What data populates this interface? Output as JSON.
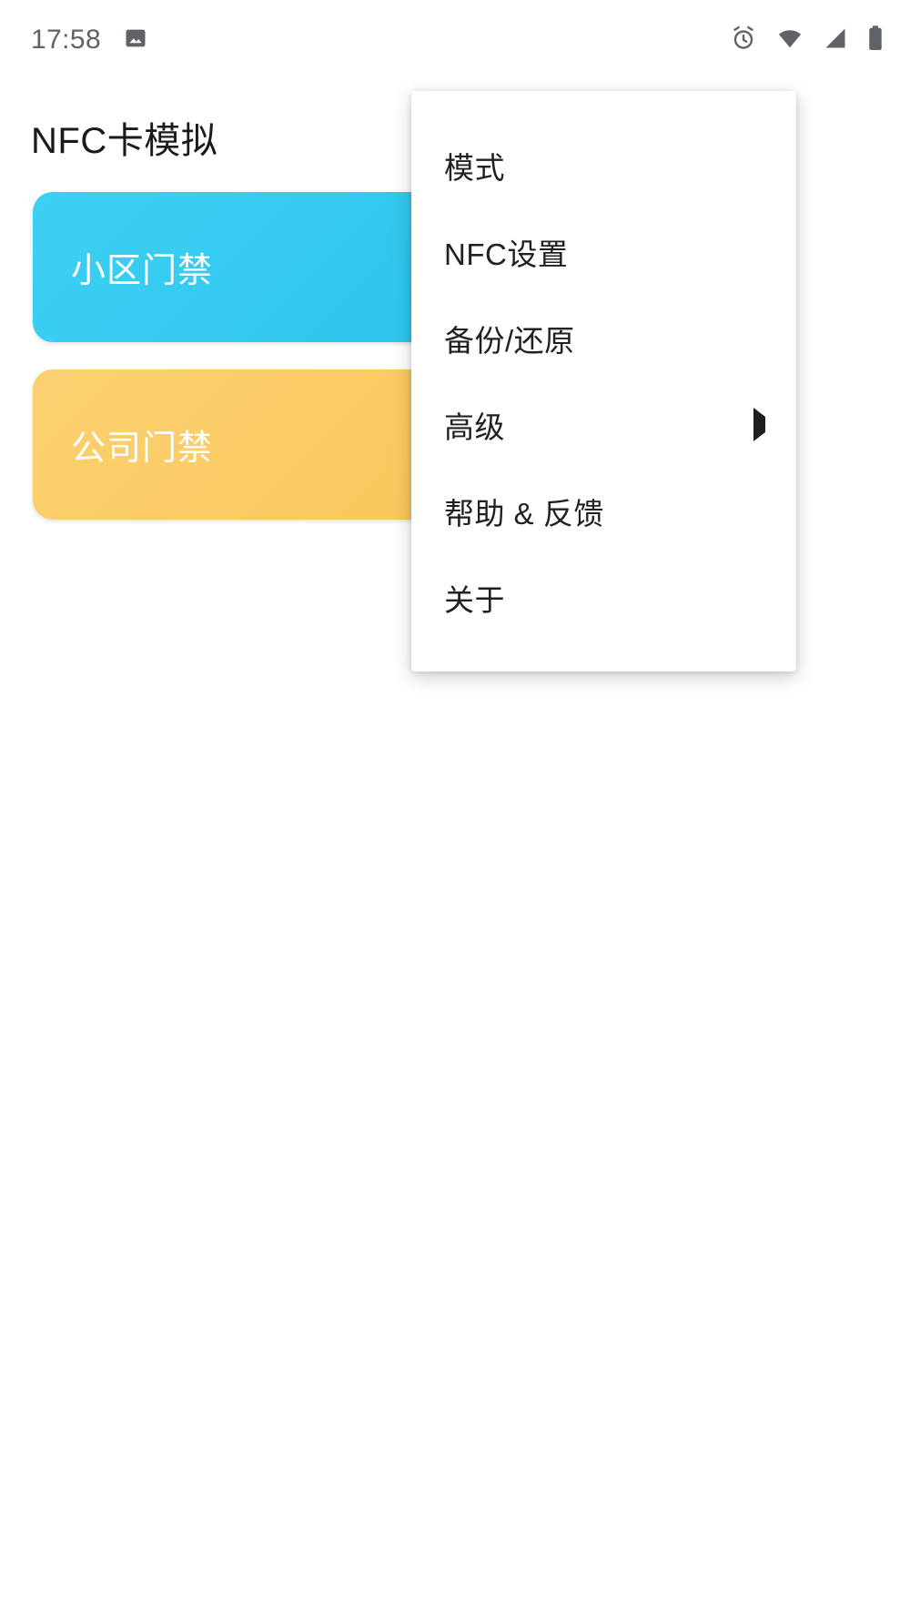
{
  "status_bar": {
    "clock": "17:58",
    "left_icons": [
      {
        "name": "photo-icon",
        "glyph": "image"
      }
    ],
    "right_icons": [
      {
        "name": "alarm-clock-icon",
        "glyph": "alarm"
      },
      {
        "name": "wifi-icon",
        "glyph": "wifi"
      },
      {
        "name": "cellular-signal-icon",
        "glyph": "signal"
      },
      {
        "name": "battery-icon",
        "glyph": "battery"
      }
    ],
    "icon_color": "#5f6368"
  },
  "header": {
    "title": "NFC卡模拟"
  },
  "cards": [
    {
      "label": "小区门禁",
      "color": "#2ec6ef",
      "theme": "blue"
    },
    {
      "label": "公司门禁",
      "color": "#fbc85f",
      "theme": "yellow"
    }
  ],
  "overflow_menu": {
    "items": [
      {
        "label": "模式",
        "has_submenu": false
      },
      {
        "label": "NFC设置",
        "has_submenu": false
      },
      {
        "label": "备份/还原",
        "has_submenu": false
      },
      {
        "label": "高级",
        "has_submenu": true
      },
      {
        "label": "帮助 & 反馈",
        "has_submenu": false
      },
      {
        "label": "关于",
        "has_submenu": false
      }
    ]
  }
}
